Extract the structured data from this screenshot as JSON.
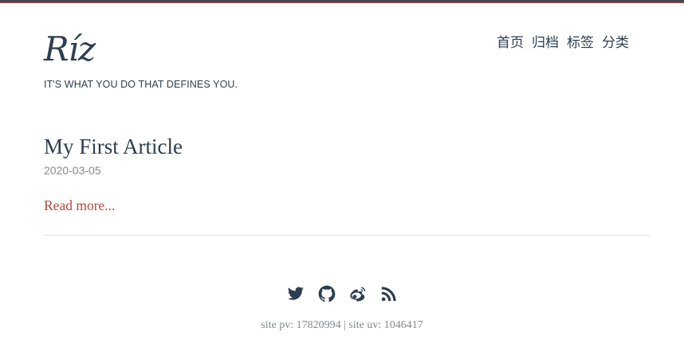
{
  "site": {
    "title": "Ríz",
    "tagline": "IT'S WHAT YOU DO THAT DEFINES YOU."
  },
  "nav": {
    "items": [
      {
        "label": "首页"
      },
      {
        "label": "归档"
      },
      {
        "label": "标签"
      },
      {
        "label": "分类"
      }
    ]
  },
  "post": {
    "title": "My First Article",
    "date": "2020-03-05",
    "read_more": "Read more..."
  },
  "footer": {
    "social_icons": [
      "twitter-icon",
      "github-icon",
      "weibo-icon",
      "rss-icon"
    ],
    "stats": "site pv: 17820994 | site uv: 1046417"
  },
  "colors": {
    "text": "#2c3e50",
    "accent": "#b5473a",
    "muted": "#7f8c8d",
    "divider": "#e3e3e3"
  }
}
